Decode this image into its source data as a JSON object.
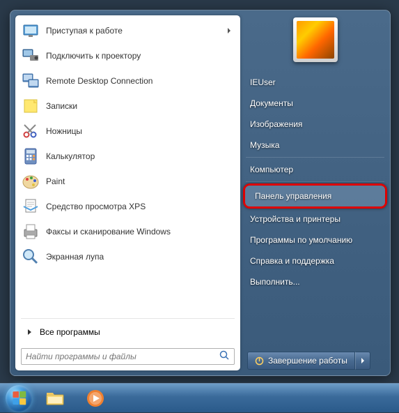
{
  "programs": [
    {
      "label": "Приступая к работе",
      "icon": "getting-started",
      "has_submenu": true
    },
    {
      "label": "Подключить к проектору",
      "icon": "projector"
    },
    {
      "label": "Remote Desktop Connection",
      "icon": "remote-desktop"
    },
    {
      "label": "Записки",
      "icon": "sticky-notes"
    },
    {
      "label": "Ножницы",
      "icon": "snipping-tool"
    },
    {
      "label": "Калькулятор",
      "icon": "calculator"
    },
    {
      "label": "Paint",
      "icon": "paint"
    },
    {
      "label": "Средство просмотра XPS",
      "icon": "xps-viewer"
    },
    {
      "label": "Факсы и сканирование Windows",
      "icon": "fax-scan"
    },
    {
      "label": "Экранная лупа",
      "icon": "magnifier"
    }
  ],
  "all_programs_label": "Все программы",
  "search": {
    "placeholder": "Найти программы и файлы"
  },
  "right_panel": {
    "user_name": "IEUser",
    "items_top": [
      "Документы",
      "Изображения",
      "Музыка"
    ],
    "items_mid": [
      "Компьютер"
    ],
    "highlighted": "Панель управления",
    "items_bottom": [
      "Устройства и принтеры",
      "Программы по умолчанию",
      "Справка и поддержка",
      "Выполнить..."
    ]
  },
  "shutdown": {
    "label": "Завершение работы"
  },
  "colors": {
    "highlight_red": "#d00000",
    "menu_bg_dark": "#3a5a7a"
  }
}
